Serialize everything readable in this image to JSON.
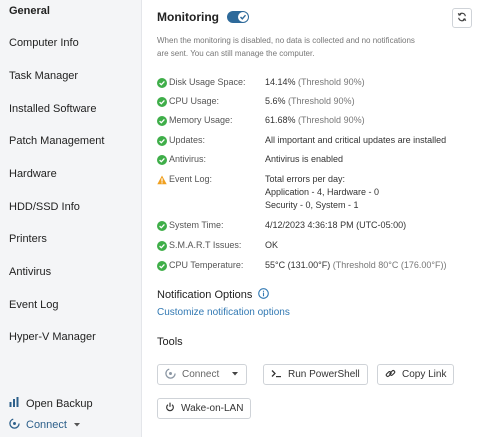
{
  "sidebar": {
    "items": [
      {
        "label": "General"
      },
      {
        "label": "Computer Info"
      },
      {
        "label": "Task Manager"
      },
      {
        "label": "Installed Software"
      },
      {
        "label": "Patch Management"
      },
      {
        "label": "Hardware"
      },
      {
        "label": "HDD/SSD Info"
      },
      {
        "label": "Printers"
      },
      {
        "label": "Antivirus"
      },
      {
        "label": "Event Log"
      },
      {
        "label": "Hyper-V Manager"
      }
    ],
    "open_backup_label": "Open Backup",
    "connect_label": "Connect"
  },
  "monitoring": {
    "title": "Monitoring",
    "enabled": true,
    "description": "When the monitoring is disabled, no data is collected and no notifications are sent. You can still manage the computer."
  },
  "status": [
    {
      "label": "Disk Usage Space:",
      "value": "14.14%",
      "threshold": "(Threshold 90%)",
      "state": "ok"
    },
    {
      "label": "CPU Usage:",
      "value": "5.6%",
      "threshold": "(Threshold 90%)",
      "state": "ok"
    },
    {
      "label": "Memory Usage:",
      "value": "61.68%",
      "threshold": "(Threshold 90%)",
      "state": "ok"
    },
    {
      "label": "Updates:",
      "value": "All important and critical updates are installed",
      "threshold": "",
      "state": "ok"
    },
    {
      "label": "Antivirus:",
      "value": "Antivirus is enabled",
      "threshold": "",
      "state": "ok"
    },
    {
      "label": "Event Log:",
      "value": "Total errors per day:",
      "value2": "Application - 4, Hardware - 0",
      "value3": "Security - 0, System - 1",
      "threshold": "",
      "state": "warning"
    },
    {
      "label": "System Time:",
      "value": "4/12/2023 4:36:18 PM (UTC-05:00)",
      "threshold": "",
      "state": "ok"
    },
    {
      "label": "S.M.A.R.T Issues:",
      "value": "OK",
      "threshold": "",
      "state": "ok"
    },
    {
      "label": "CPU Temperature:",
      "value": "55°C (131.00°F)",
      "threshold": "(Threshold 80°C (176.00°F))",
      "state": "ok"
    }
  ],
  "notification": {
    "title": "Notification Options",
    "link": "Customize notification options"
  },
  "tools": {
    "title": "Tools",
    "connect_label": "Connect",
    "powershell_label": "Run PowerShell",
    "copy_link_label": "Copy Link",
    "wol_label": "Wake-on-LAN"
  },
  "colors": {
    "ok": "#3fae49",
    "warning": "#f0a020",
    "accent": "#2e6a9a",
    "link": "#3279b3"
  }
}
